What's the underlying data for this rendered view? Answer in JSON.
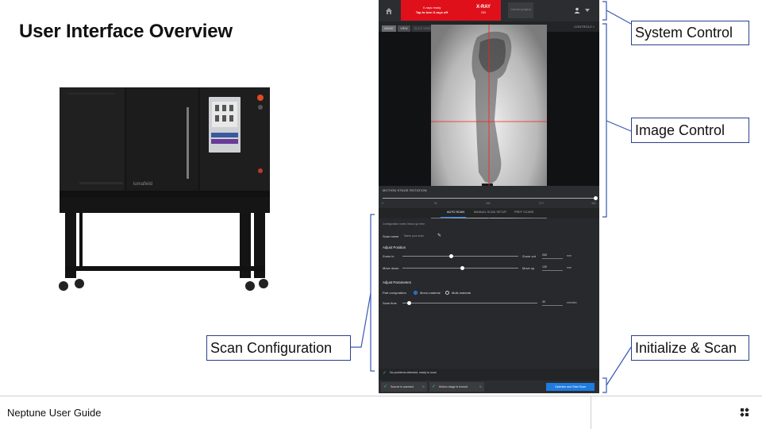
{
  "slide": {
    "title": "User Interface Overview",
    "footer": "Neptune User Guide"
  },
  "ui": {
    "banner": {
      "line1": "X-rays ready",
      "line2": "Tap to turn X-rays off",
      "status": "X-RAY",
      "status_sub": "ON"
    },
    "cancel_label": "Cancel project",
    "view_tabs": [
      "IMAGE",
      "VIEW",
      "SLICE VIEW"
    ],
    "controls_label": "CONTROLS",
    "rotation": {
      "label": "MOTION STAGE ROTATION",
      "ticks": [
        "0",
        "90",
        "180",
        "270",
        "360"
      ],
      "value_fraction": 1.0
    },
    "tabs": [
      "AUTO SCAN",
      "MANUAL SCAN SETUP",
      "PREF SCANS"
    ],
    "active_tab": "AUTO SCAN",
    "form": {
      "intro": "Configuration notes: Neuro go here",
      "scan_name_label": "Scan name",
      "scan_name_placeholder": "Name your scan",
      "adjust_position": "Adjust Position",
      "zoom_in": "Zoom in",
      "zoom_out": "Zoom out",
      "zoom_value": "250",
      "zoom_unit": "mm",
      "zoom_fraction": 0.42,
      "move_down": "Move down",
      "move_up": "Move up",
      "move_value": "130",
      "move_unit": "mm",
      "move_fraction": 0.52,
      "adjust_parameters": "Adjust Parameters",
      "part_composition": "Part composition",
      "mono_material": "Mono-material",
      "multi_material": "Multi-material",
      "scan_time_label": "Scan time",
      "scan_time_value": "30",
      "scan_time_unit": "minutes",
      "scan_time_fraction": 0.05
    },
    "status_text": "No problems detected, ready to scan",
    "bottom": {
      "source": "Source is warmed",
      "stage": "Motion stage is homed",
      "scan_button": "Optimize and Start Scan"
    }
  },
  "callouts": {
    "system_control": "System Control",
    "image_control": "Image Control",
    "scan_configuration": "Scan Configuration",
    "initialize_scan": "Initialize & Scan"
  },
  "machine": {
    "brand": "lumafield"
  },
  "colors": {
    "xray_red": "#e0101b",
    "accent_blue": "#1e7be0",
    "callout_border": "#2b3f8f",
    "ui_dark": "#222426"
  }
}
